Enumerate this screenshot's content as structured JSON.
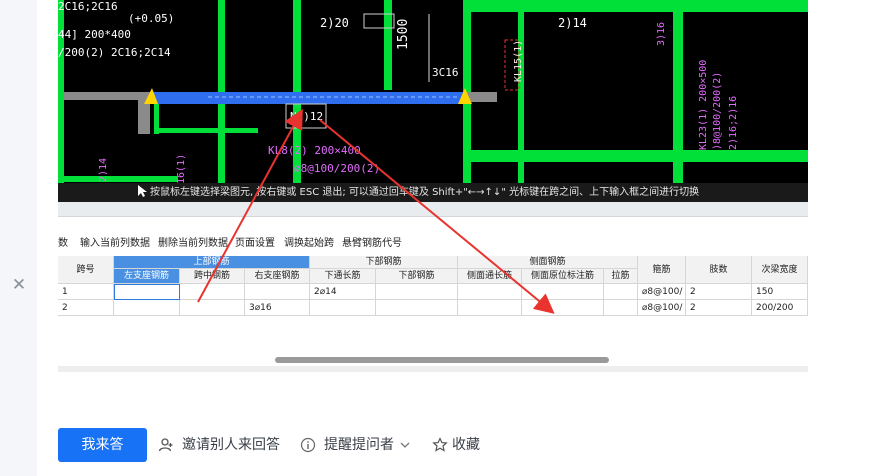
{
  "cad": {
    "labels": {
      "left_offset": "(+0.05)",
      "left_top": "2C16;2C16",
      "left_section": "44] 200*400",
      "left_stirrup": "/200(2) 2C16;2C14",
      "top_mid1": "2)20",
      "top_mid2": "2)14",
      "dim": "1500",
      "kl15": "KL15(1)",
      "c16": "3C16",
      "n_bar": "N2)12",
      "kl8": "KL8(2) 200×400",
      "kl8_stirrup": "⌀8@100/200(2)",
      "kl23": "KL23(1) 200×500",
      "kl23_stirrup": ")8@100/200(2)",
      "kl23_bar": "2)16;2)16",
      "right_top": "3)16",
      "left_vert1": "16(1)",
      "left_vert2": "2)14"
    },
    "status_text": "按鼠标左键选择梁图元, 按右键或 ESC 退出; 可以通过回车键及 Shift+\"←→↑↓\" 光标键在跨之间、上下输入框之间进行切换"
  },
  "toolbar": {
    "items": [
      "数",
      "输入当前列数据",
      "删除当前列数据",
      "页面设置",
      "调换起始跨",
      "悬臂钢筋代号"
    ]
  },
  "grid": {
    "group_headers": {
      "top_steel": "上部钢筋",
      "bottom_steel": "下部钢筋",
      "side_steel": "侧面钢筋"
    },
    "columns": {
      "span_no": "跨号",
      "left_support": "左支座钢筋",
      "mid_span": "跨中钢筋",
      "right_support": "右支座钢筋",
      "bottom_through": "下通长筋",
      "bottom_steel": "下部钢筋",
      "side_through": "侧面通长筋",
      "side_in_situ": "侧面原位标注筋",
      "tie_bar": "拉筋",
      "stirrup": "箍筋",
      "legs": "肢数",
      "sub_beam_width": "次梁宽度"
    },
    "rows": [
      {
        "span_no": "1",
        "bottom_through": "2⌀14",
        "stirrup": "⌀8@100/",
        "legs": "2",
        "sub_beam_width": "150",
        "right_support": ""
      },
      {
        "span_no": "2",
        "right_support": "3⌀16",
        "stirrup": "⌀8@100/",
        "legs": "2",
        "sub_beam_width": "200/200",
        "bottom_through": ""
      }
    ]
  },
  "actions": {
    "answer": "我来答",
    "invite": "邀请别人来回答",
    "remind": "提醒提问者",
    "favorite": "收藏"
  },
  "colors": {
    "beam_green": "#00e038",
    "selected_beam_blue": "#2f6fef",
    "annotation_red": "#e8332e",
    "primary_button": "#1772f6"
  }
}
